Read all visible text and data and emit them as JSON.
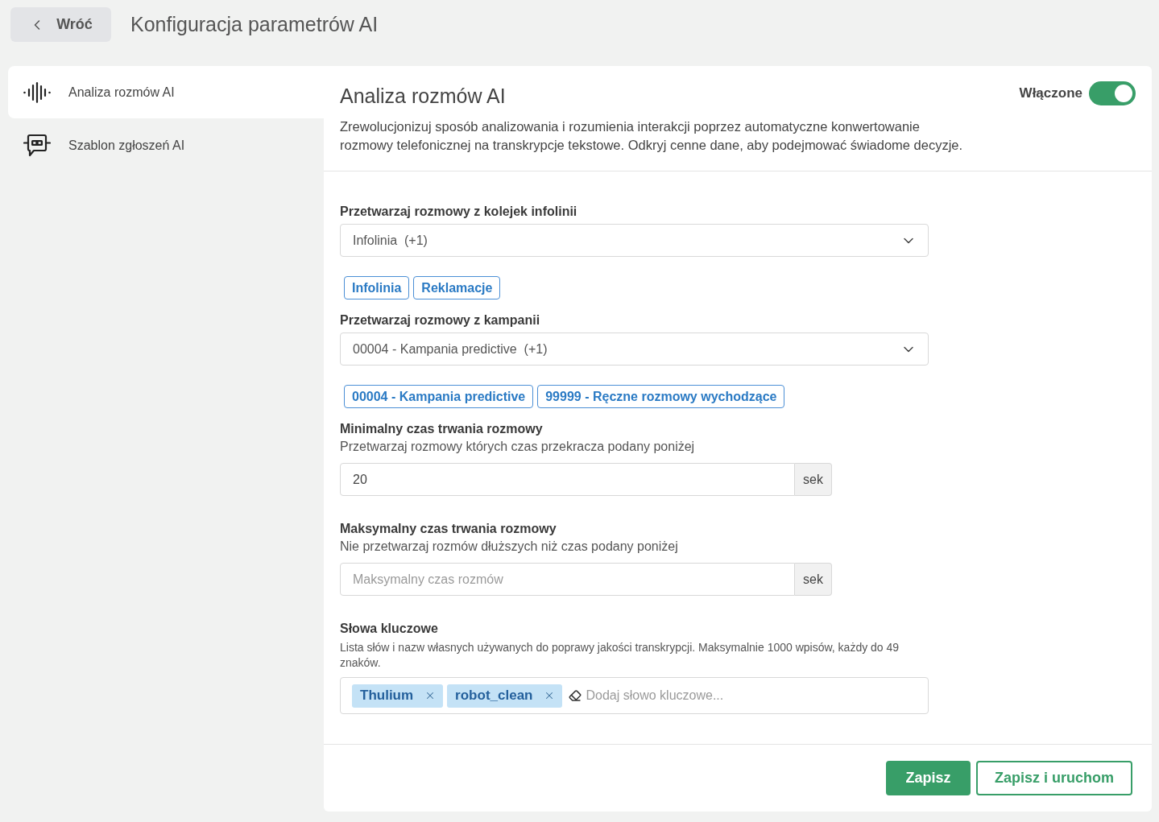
{
  "header": {
    "back_button": {
      "label": "Wróć"
    },
    "title": "Konfiguracja parametrów AI"
  },
  "sidebar": {
    "items": [
      {
        "label": "Analiza rozmów AI",
        "selected": true
      },
      {
        "label": "Szablon zgłoszeń AI",
        "selected": false
      }
    ]
  },
  "panel": {
    "title": "Analiza rozmów AI",
    "toggle": {
      "label": "Włączone",
      "on": true
    },
    "description": "Zrewolucjonizuj sposób analizowania i rozumienia interakcji poprzez automatyczne konwertowanie rozmowy telefonicznej na transkrypcje tekstowe. Odkryj cenne dane, aby podejmować świadome decyzje."
  },
  "form": {
    "fields": [
      {
        "kind": "multiselect",
        "label": "Przetwarzaj rozmowy z kolejek infolinii",
        "value": "Infolinia  (+1)",
        "tags": [
          "Infolinia",
          "Reklamacje"
        ]
      },
      {
        "kind": "multiselect",
        "label": "Przetwarzaj rozmowy z kampanii",
        "value": "00004 - Kampania predictive  (+1)",
        "tags": [
          "00004 - Kampania predictive",
          "99999 - Ręczne rozmowy wychodzące"
        ]
      },
      {
        "kind": "duration",
        "label": "Minimalny czas trwania rozmowy",
        "hint": "Przetwarzaj rozmowy których czas przekracza podany poniżej",
        "value": "20",
        "unit": "sek"
      },
      {
        "kind": "duration",
        "label": "Maksymalny czas trwania rozmowy",
        "hint": "Nie przetwarzaj rozmów dłuższych niż czas podany poniżej",
        "placeholder": "Maksymalny czas rozmów",
        "unit": "sek"
      },
      {
        "kind": "keywords",
        "label": "Słowa kluczowe",
        "hint": "Lista słów i nazw własnych używanych do poprawy jakości transkrypcji. Maksymalnie 1000 wpisów, każdy do 49 znaków.",
        "chips": [
          "Thulium",
          "robot_clean"
        ],
        "placeholder": "Dodaj słowo kluczowe..."
      }
    ]
  },
  "footer": {
    "buttons": [
      {
        "label": "Zapisz",
        "kind": "primary"
      },
      {
        "label": "Zapisz i uruchom",
        "kind": "outline"
      }
    ]
  }
}
